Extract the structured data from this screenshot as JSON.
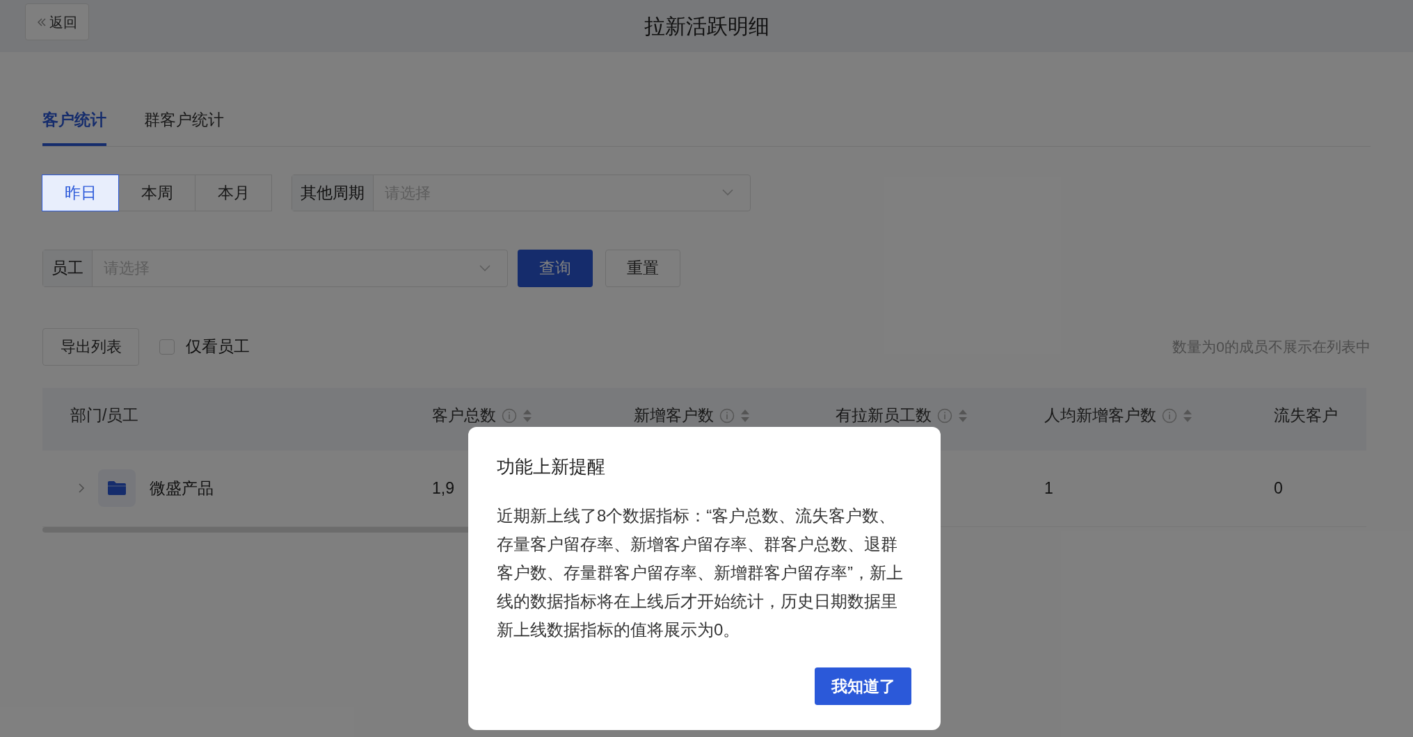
{
  "header": {
    "back": "返回",
    "title": "拉新活跃明细"
  },
  "tabs": [
    {
      "label": "客户统计",
      "selected": true
    },
    {
      "label": "群客户统计",
      "selected": false
    }
  ],
  "periods": [
    {
      "label": "昨日",
      "selected": true
    },
    {
      "label": "本周",
      "selected": false
    },
    {
      "label": "本月",
      "selected": false
    }
  ],
  "other_period": {
    "label": "其他周期",
    "placeholder": "请选择"
  },
  "employee_filter": {
    "label": "员工",
    "placeholder": "请选择"
  },
  "buttons": {
    "query": "查询",
    "reset": "重置",
    "export": "导出列表"
  },
  "only_staff": {
    "label": "仅看员工",
    "checked": false
  },
  "note": "数量为0的成员不展示在列表中",
  "table": {
    "columns": [
      {
        "label": "部门/员工",
        "info": false,
        "sortable": false
      },
      {
        "label": "客户总数",
        "info": true,
        "sortable": true
      },
      {
        "label": "新增客户数",
        "info": true,
        "sortable": true
      },
      {
        "label": "有拉新员工数",
        "info": true,
        "sortable": true
      },
      {
        "label": "人均新增客户数",
        "info": true,
        "sortable": true
      },
      {
        "label": "流失客户",
        "info": false,
        "sortable": false
      }
    ],
    "rows": [
      {
        "cells": [
          "微盛产品",
          "1,9",
          "",
          "",
          "1",
          "0"
        ],
        "expanded": false
      }
    ]
  },
  "dialog": {
    "title": "功能上新提醒",
    "body": "近期新上线了8个数据指标：“客户总数、流失客户数、存量客户留存率、新增客户留存率、群客户总数、退群客户数、存量群客户留存率、新增群客户留存率”，新上线的数据指标将在上线后才开始统计，历史日期数据里新上线数据指标的值将展示为0。",
    "button": "我知道了"
  }
}
